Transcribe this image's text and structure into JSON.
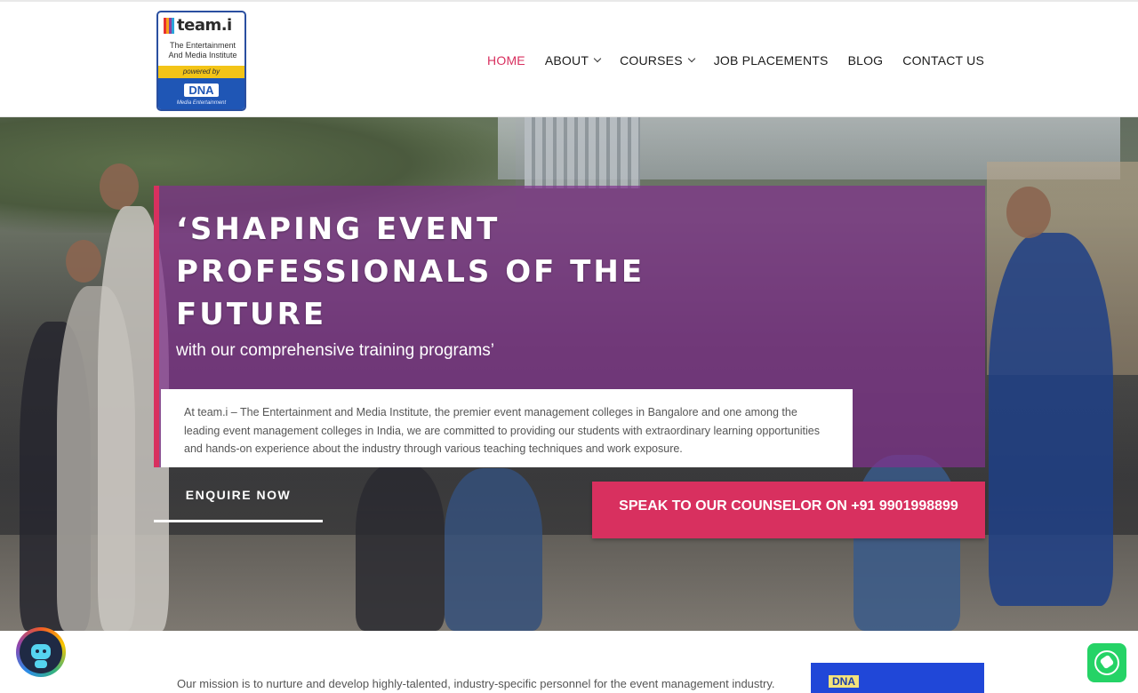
{
  "logo": {
    "word": "team.i",
    "subtitle_line1": "The Entertainment",
    "subtitle_line2": "And Media Institute",
    "powered_by": "powered by",
    "dna": "DNA",
    "tagline": "Media Entertainment"
  },
  "nav": {
    "items": [
      {
        "label": "HOME",
        "active": true,
        "dropdown": false
      },
      {
        "label": "ABOUT",
        "active": false,
        "dropdown": true
      },
      {
        "label": "COURSES",
        "active": false,
        "dropdown": true
      },
      {
        "label": "JOB PLACEMENTS",
        "active": false,
        "dropdown": false
      },
      {
        "label": "BLOG",
        "active": false,
        "dropdown": false
      },
      {
        "label": "CONTACT US",
        "active": false,
        "dropdown": false
      }
    ]
  },
  "hero": {
    "title_line1": "‘SHAPING EVENT",
    "title_line2": "PROFESSIONALS OF THE",
    "title_line3": "FUTURE",
    "subtitle": "with our comprehensive training programs’",
    "intro": "At team.i – The Entertainment and Media Institute, the premier event management colleges in Bangalore and one among the leading event management colleges in India, we are committed to providing our students with extraordinary learning opportunities and hands-on experience about the industry through various teaching techniques and work exposure.",
    "enquire_label": "ENQUIRE NOW",
    "counselor_label": "SPEAK TO OUR COUNSELOR ON +91 9901998899"
  },
  "mission": {
    "text": "Our mission is to nurture and develop highly-talented, industry-specific personnel for the event management industry."
  },
  "thumbnail": {
    "dna": "DNA"
  },
  "colors": {
    "accent": "#d8305f",
    "overlay": "#80328c",
    "whatsapp": "#25d366"
  }
}
